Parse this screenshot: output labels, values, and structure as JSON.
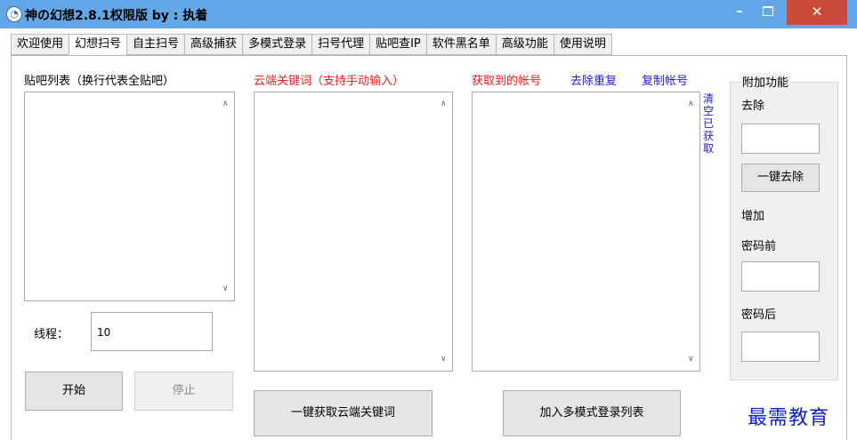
{
  "window": {
    "title": "神の幻想2.8.1权限版 by : 执着",
    "min_glyph": "–",
    "close_glyph": "✕",
    "icon_glyph": "◔"
  },
  "tabs": [
    {
      "label": "欢迎使用"
    },
    {
      "label": "幻想扫号"
    },
    {
      "label": "自主扫号"
    },
    {
      "label": "高级捕获"
    },
    {
      "label": "多模式登录"
    },
    {
      "label": "扫号代理"
    },
    {
      "label": "贴吧查IP"
    },
    {
      "label": "软件黑名单"
    },
    {
      "label": "高级功能"
    },
    {
      "label": "使用说明"
    }
  ],
  "active_tab": "幻想扫号",
  "tieba": {
    "label": "贴吧列表（换行代表全贴吧）",
    "value": ""
  },
  "threads": {
    "label": "线程：",
    "value": "10"
  },
  "buttons": {
    "start": "开始",
    "stop": "停止",
    "fetch_keywords": "一键获取云端关键词",
    "add_multi_login": "加入多模式登录列表",
    "one_click_remove": "一键去除"
  },
  "cloud": {
    "label": "云端关键词（支持手动输入）",
    "value": ""
  },
  "accounts": {
    "label": "获取到的帐号",
    "dedupe_link": "去除重复",
    "copy_link": "复制帐号",
    "clear_link": "清空已获取",
    "value": ""
  },
  "extra": {
    "group_title": "附加功能",
    "remove_label": "去除",
    "remove_value": "",
    "add_label": "增加",
    "prefix_label": "密码前",
    "prefix_value": "",
    "suffix_label": "密码后",
    "suffix_value": ""
  },
  "watermark": "最需教育",
  "colors": {
    "titlebar": "#62a8e8",
    "close": "#c94b3b",
    "red_label": "#f01c1c",
    "blue_link": "#1c1ce0"
  },
  "scroll_glyphs": {
    "up": "∧",
    "down": "∨"
  }
}
